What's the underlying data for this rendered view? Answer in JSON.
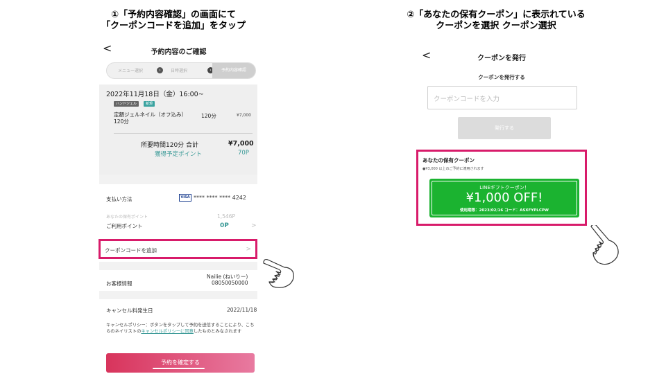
{
  "captions": {
    "step1": [
      "①「予約内容確認」の画面にて",
      "「クーポンコードを追加」をタップ"
    ],
    "step2": [
      "②「あなたの保有クーポン」に表示れている",
      "クーポンを選択 クーポン選択"
    ]
  },
  "screen1": {
    "back_glyph": "<",
    "title": "予約内容のご確認",
    "steps": [
      "メニュー選択",
      "日時選択",
      "予約内容確認"
    ],
    "date": "2022年11月18日（金）16:00~",
    "tags": [
      "ハンドジェル",
      "新規"
    ],
    "menu_name": [
      "定額ジェルネイル（オフ込み）",
      "120分"
    ],
    "menu_duration": "120分",
    "menu_price": "¥7,000",
    "total_label": "所要時間120分  合計",
    "total_price": "¥7,000",
    "points_label": "獲得予定ポイント",
    "points_value": "70P",
    "payment_label": "支払い方法",
    "card_brand": "VISA",
    "card_number": "**** **** **** 4242",
    "owned_points_label": "あなたの保有ポイント",
    "owned_points_value": "1,546P",
    "use_points_label": "ご利用ポイント",
    "use_points_value": "0P",
    "chevron": ">",
    "coupon_label": "クーポンコードを追加",
    "customer_label": "お客様情報",
    "customer_name": "Nailie (ねいりー)",
    "customer_tel": "08050050000",
    "cancel_label": "キャンセル料発生日",
    "cancel_date": "2022/11/18",
    "policy_pre": "キャンセルポリシー：ボタンをタップして予約を送信することにより、こちらのネイリストの",
    "policy_link": "キャンセルポリシー",
    "policy_link_post": "に同意",
    "policy_post": "したものとみなされます",
    "confirm_button": "予約を確定する"
  },
  "screen2": {
    "back_glyph": "<",
    "title": "クーポンを発行",
    "subtitle": "クーポンを発行する",
    "input_placeholder": "クーポンコードを入力",
    "issue_button": "発行する",
    "owned_title": "あなたの保有クーポン",
    "owned_note": "●¥3,000 以上のご予約に適用されます",
    "coupon_brand": "LINEギフトクーポン！",
    "coupon_amount": "¥1,000 OFF!",
    "coupon_expiry": "使用期限：2023/02/16 コード：ASXFYPLCPW"
  },
  "colors": {
    "highlight": "#d81b6a",
    "accent_teal": "#3a9a97",
    "coupon_green": "#1bb330",
    "confirm_gradient": [
      "#d8345c",
      "#e87aa0"
    ]
  },
  "icons": [
    "back-chevron-icon",
    "step-arrow-icon",
    "visa-card-icon",
    "pointing-hand-icon"
  ]
}
